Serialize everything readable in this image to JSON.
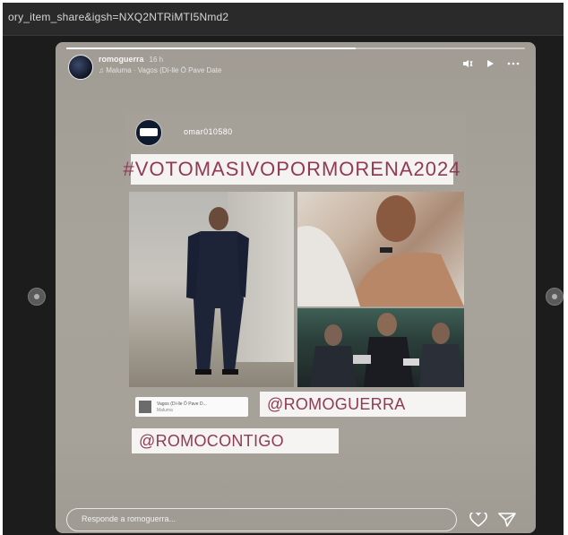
{
  "browser": {
    "url": "ory_item_share&igsh=NXQ2NTRiMTI5Nmd2"
  },
  "story": {
    "progress": 0.63,
    "header": {
      "username": "romoguerra",
      "time": "16 h",
      "music": "♫ Maluma · Vagos (Dí-lle Ô Pave Date"
    },
    "reshared": {
      "username": "omar010580",
      "hashtag": "#VOTOMASIVOPORMORENA2024",
      "music_sticker": {
        "line1": "Vagos (Dí-lle Ô Pave D...",
        "line2": "Maluma"
      },
      "mention_1": "@ROMOGUERRA",
      "mention_2": "@ROMOCONTIGO"
    },
    "reply_placeholder": "Responde a romoguerra..."
  },
  "icons": {
    "nav_prev": "circle-icon",
    "nav_next": "circle-icon",
    "mute": "speaker-icon",
    "play": "play-icon",
    "more": "more-icon",
    "like": "heart-icon",
    "share": "send-icon"
  },
  "colors": {
    "accent_mention": "#8f3a57"
  }
}
